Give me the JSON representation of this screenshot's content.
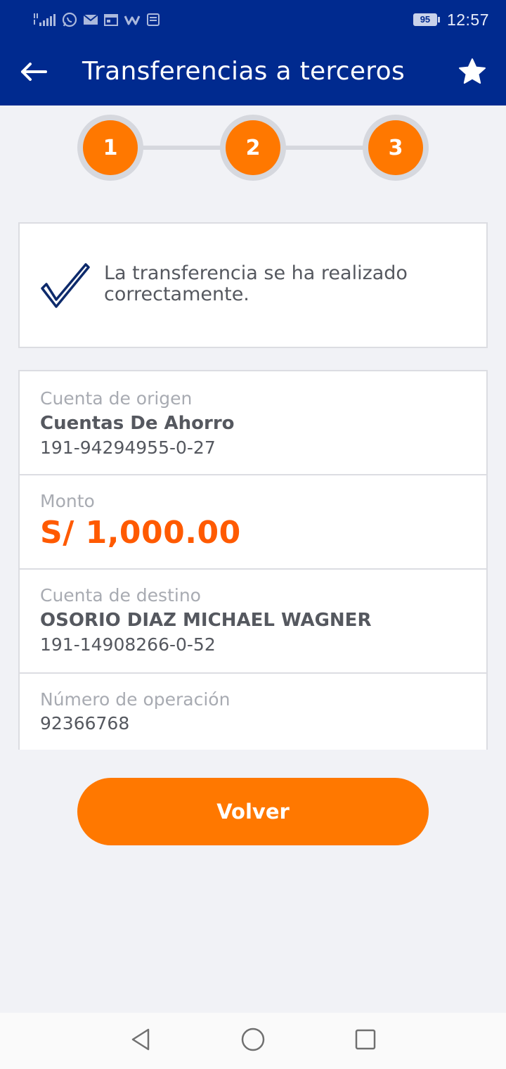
{
  "status_bar": {
    "battery": "95",
    "time": "12:57",
    "icons": [
      "signal-icon",
      "whatsapp-icon",
      "mail-icon",
      "calendar-icon",
      "w-app-icon",
      "notes-icon"
    ]
  },
  "header": {
    "title": "Transferencias a terceros",
    "back_icon": "arrow-left-icon",
    "favorite_icon": "star-icon"
  },
  "stepper": {
    "steps": [
      "1",
      "2",
      "3"
    ],
    "current": 3
  },
  "success": {
    "message": "La transferencia se ha realizado correctamente.",
    "icon": "checkmark-icon"
  },
  "details": {
    "origin": {
      "label": "Cuenta de origen",
      "name": "Cuentas De Ahorro",
      "number": "191-94294955-0-27"
    },
    "amount": {
      "label": "Monto",
      "value": "S/ 1,000.00"
    },
    "destination": {
      "label": "Cuenta de destino",
      "name": "OSORIO DIAZ MICHAEL WAGNER",
      "number": "191-14908266-0-52"
    },
    "operation": {
      "label": "Número de operación",
      "value": "92366768"
    }
  },
  "actions": {
    "back_label": "Volver"
  },
  "colors": {
    "brand_blue": "#002a8f",
    "accent_orange": "#ff7800",
    "amount_orange": "#ff5a00"
  }
}
